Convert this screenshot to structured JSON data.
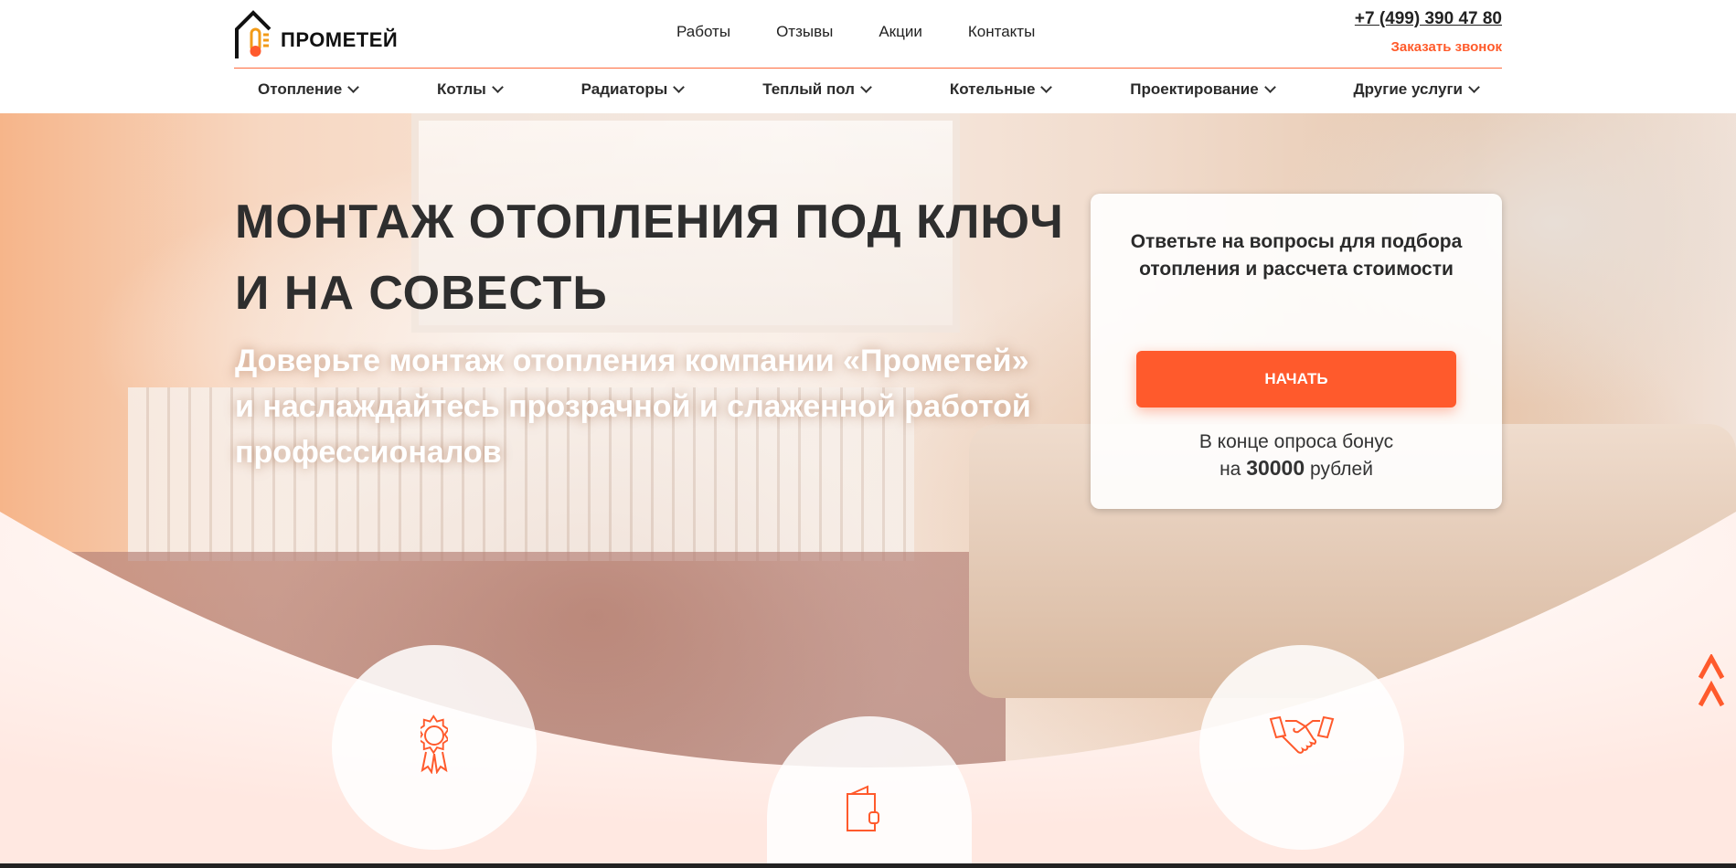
{
  "header": {
    "logo_text": "ПРОМЕТЕЙ",
    "top_nav": [
      "Работы",
      "Отзывы",
      "Акции",
      "Контакты"
    ],
    "phone": "+7 (499) 390 47 80",
    "callback": "Заказать звонок"
  },
  "menu": [
    "Отопление",
    "Котлы",
    "Радиаторы",
    "Теплый пол",
    "Котельные",
    "Проектирование",
    "Другие услуги"
  ],
  "hero": {
    "title_line1": "МОНТАЖ ОТОПЛЕНИЯ ПОД КЛЮЧ",
    "title_line2": "И НА СОВЕСТЬ",
    "subtitle": "Доверьте монтаж отопления компании «Прометей» и наслаждайтесь прозрачной и слаженной работой профессионалов"
  },
  "card": {
    "title": "Ответьте на вопросы для подбора отопления и рассчета стоимости",
    "button": "НАЧАТЬ",
    "bonus_prefix": "В конце опроса бонус",
    "bonus_na": "на",
    "bonus_amount": "30000",
    "bonus_suffix": "рублей"
  },
  "icons": [
    "award-icon",
    "wallet-icon",
    "handshake-icon"
  ],
  "colors": {
    "accent": "#ff5a2c",
    "text": "#2b2b2b"
  }
}
